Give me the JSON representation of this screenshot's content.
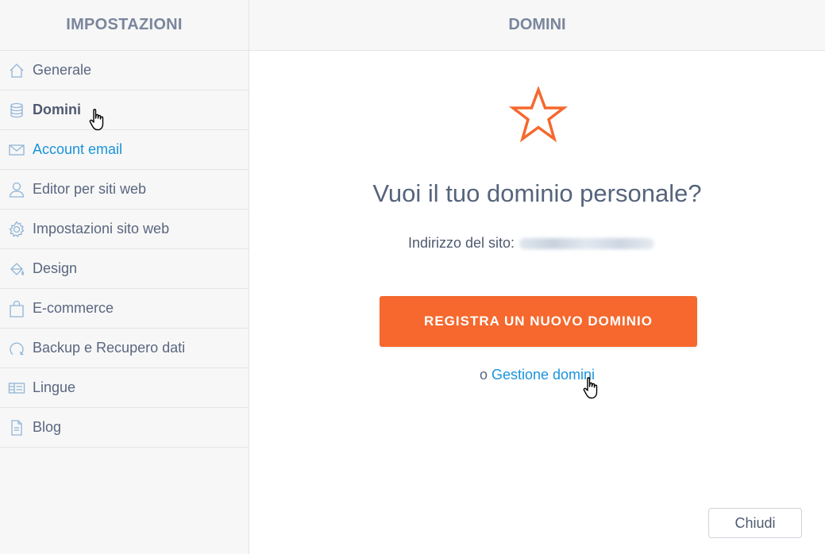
{
  "sidebar": {
    "title": "IMPOSTAZIONI",
    "items": [
      {
        "label": "Generale",
        "icon": "home-icon"
      },
      {
        "label": "Domini",
        "icon": "database-icon"
      },
      {
        "label": "Account email",
        "icon": "envelope-icon"
      },
      {
        "label": "Editor per siti web",
        "icon": "user-icon"
      },
      {
        "label": "Impostazioni sito web",
        "icon": "gear-icon"
      },
      {
        "label": "Design",
        "icon": "paint-bucket-icon"
      },
      {
        "label": "E-commerce",
        "icon": "shopping-bag-icon"
      },
      {
        "label": "Backup e Recupero dati",
        "icon": "refresh-icon"
      },
      {
        "label": "Lingue",
        "icon": "languages-icon"
      },
      {
        "label": "Blog",
        "icon": "document-icon"
      }
    ],
    "active_item": "Domini"
  },
  "header": {
    "title": "DOMINI"
  },
  "main": {
    "headline": "Vuoi il tuo dominio personale?",
    "site_label": "Indirizzo del sito:",
    "cta_label": "REGISTRA UN NUOVO DOMINIO",
    "alt_prefix": "o",
    "alt_link": "Gestione domini",
    "close_label": "Chiudi"
  },
  "colors": {
    "accent": "#f6682d",
    "link": "#1a94db",
    "icon": "#8fb5d8",
    "text": "#5a6680"
  }
}
